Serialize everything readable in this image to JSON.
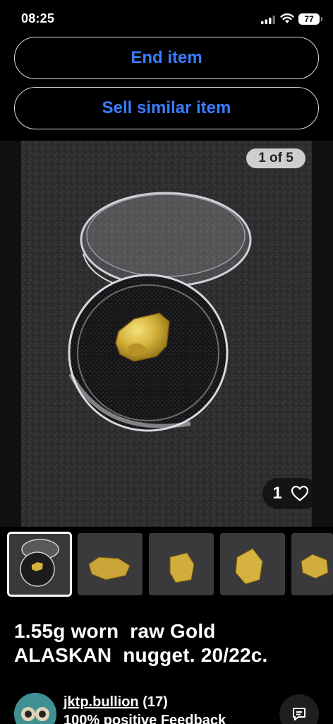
{
  "status_bar": {
    "time": "08:25",
    "battery": "77",
    "icons": [
      "signal-icon",
      "wifi-icon",
      "battery-icon"
    ]
  },
  "actions": {
    "end_item": "End item",
    "sell_similar": "Sell similar item"
  },
  "gallery": {
    "counter": "1 of 5",
    "watch_count": "1",
    "thumbnail_count": 5,
    "selected_index": 0
  },
  "listing": {
    "title": "1.55g worn  raw Gold\nALASKAN  nugget. 20/22c."
  },
  "seller": {
    "name": "jktp.bullion",
    "rating": "(17)",
    "feedback": "100% positive Feedback"
  },
  "colors": {
    "accent": "#3b7cff",
    "background": "#000000",
    "gold": "#d4b13a"
  }
}
